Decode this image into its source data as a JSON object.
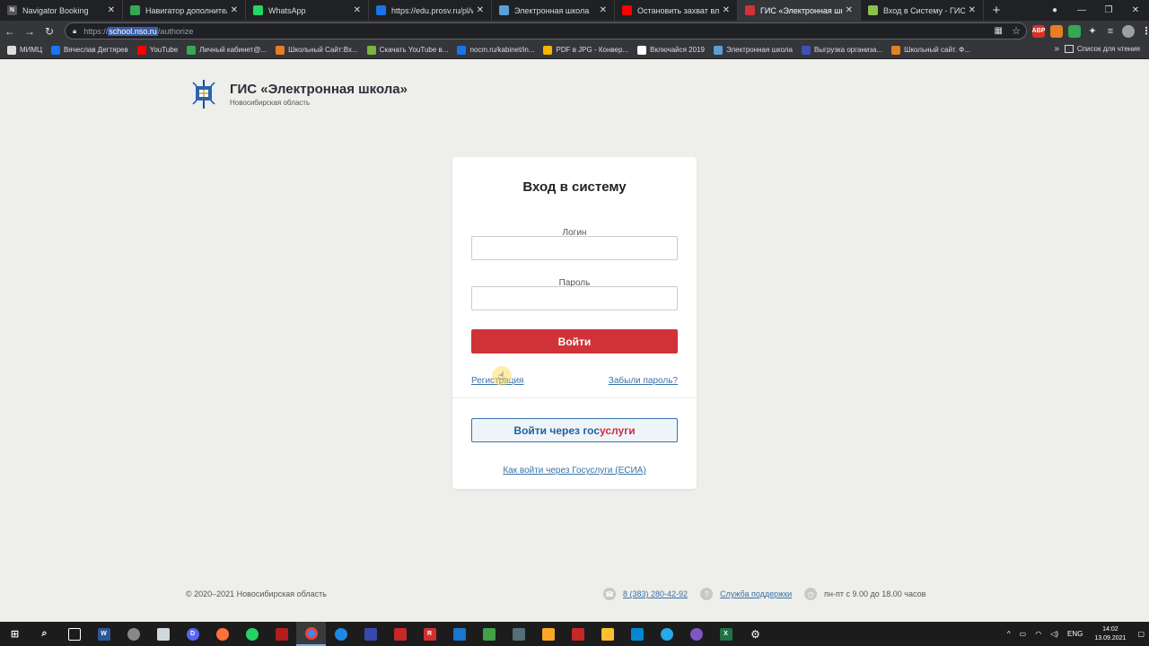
{
  "browser": {
    "tabs": [
      {
        "label": "Navigator Booking",
        "fav_color": "#555555",
        "fav_char": "N",
        "active": false
      },
      {
        "label": "Навигатор дополнительн",
        "fav_color": "#34a853",
        "fav_char": "",
        "active": false
      },
      {
        "label": "WhatsApp",
        "fav_color": "#25d366",
        "fav_char": "",
        "active": false
      },
      {
        "label": "https://edu.prosv.ru/pl/wor",
        "fav_color": "#1a73e8",
        "fav_char": "",
        "active": false
      },
      {
        "label": "Электронная школа",
        "fav_color": "#5aa0d8",
        "fav_char": "",
        "active": false
      },
      {
        "label": "Остановить захват власти",
        "fav_color": "#ff0000",
        "fav_char": "",
        "active": false
      },
      {
        "label": "ГИС «Электронная школа»",
        "fav_color": "#cf3338",
        "fav_char": "",
        "active": true
      },
      {
        "label": "Вход в Систему - ГИС НС",
        "fav_color": "#8bc34a",
        "fav_char": "",
        "active": false
      }
    ],
    "address": {
      "scheme": "https://",
      "host": "school.nso.ru",
      "path": "/authorize"
    },
    "bookmarks": [
      {
        "label": "МИМЦ",
        "color": "#dddddd"
      },
      {
        "label": "Вячеслав Дегтярев",
        "color": "#1877f2"
      },
      {
        "label": "YouTube",
        "color": "#ff0000"
      },
      {
        "label": "Личный кабинет@...",
        "color": "#34a853"
      },
      {
        "label": "Школьный Сайт:Вх...",
        "color": "#e67e22"
      },
      {
        "label": "Скачать YouTube в...",
        "color": "#7cb342"
      },
      {
        "label": "nocm.ru/kabinet/in...",
        "color": "#1a73e8"
      },
      {
        "label": "PDF в JPG - Конвер...",
        "color": "#f4b400"
      },
      {
        "label": "Включайся 2019",
        "color": "#ffffff"
      },
      {
        "label": "Электронная школа",
        "color": "#5aa0d8"
      },
      {
        "label": "Выгрузка организа...",
        "color": "#3f51b5"
      },
      {
        "label": "Школьный сайт. Ф...",
        "color": "#e67e22"
      }
    ],
    "reading_list": "Список для чтения"
  },
  "page": {
    "brand_title": "ГИС «Электронная школа»",
    "brand_subtitle": "Новосибирская область",
    "login_title": "Вход в систему",
    "login_label": "Логин",
    "password_label": "Пароль",
    "submit_label": "Войти",
    "register_link": "Регистрация",
    "forgot_link": "Забыли пароль?",
    "gos_prefix": "Войти через ",
    "gos_part1": "гос",
    "gos_part2": "услуги",
    "esia_link": "Как войти через Госуслуги (ЕСИА)"
  },
  "footer": {
    "copyright": "© 2020–2021 Новосибирская область",
    "phone": "8 (383) 280-42-92",
    "support": "Служба поддержки",
    "hours": "пн-пт с 9.00 до 18.00 часов"
  },
  "taskbar": {
    "lang": "ENG",
    "time": "14:02",
    "date": "13.09.2021"
  }
}
